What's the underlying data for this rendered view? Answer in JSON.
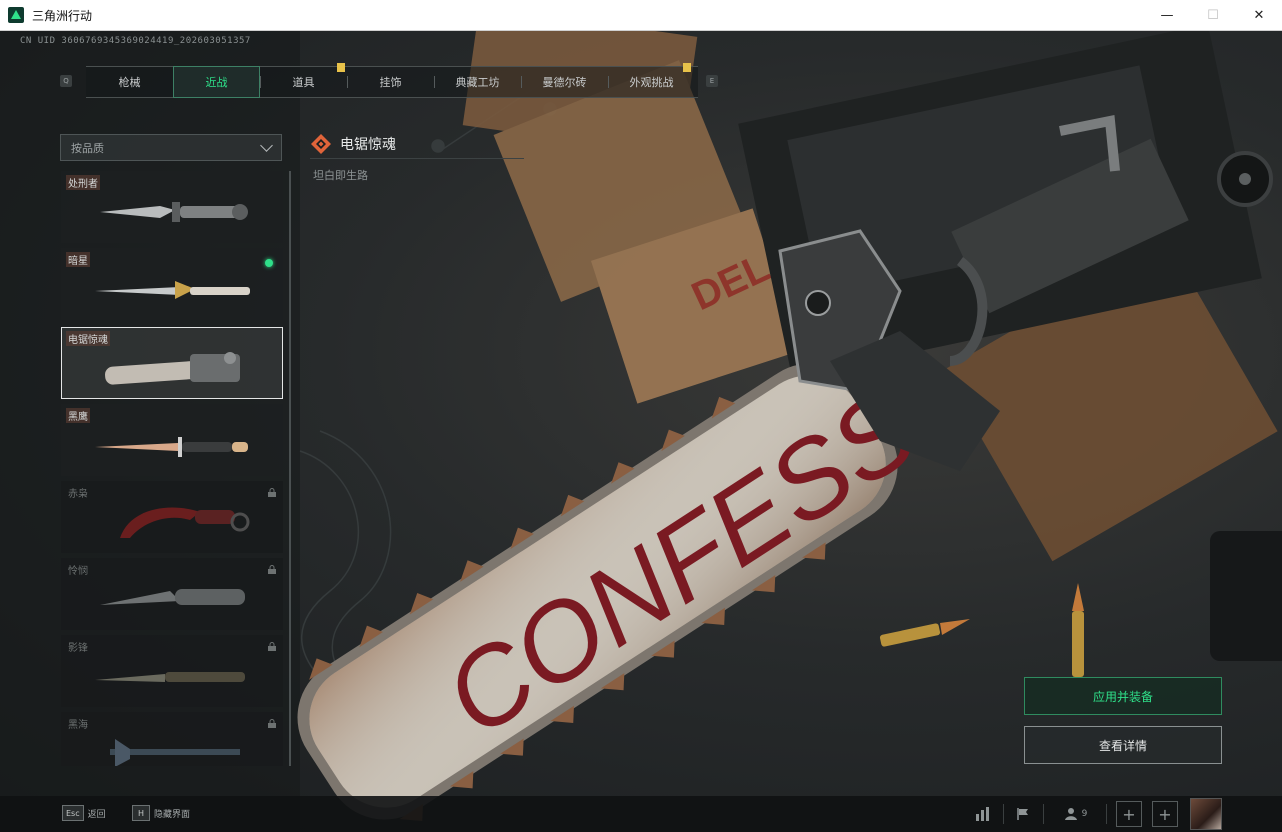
{
  "window": {
    "title": "三角洲行动",
    "minimize": "—",
    "maximize": "☐",
    "close": "✕"
  },
  "uid": "CN UID 3606769345369024419_202603051357",
  "tabs": {
    "left_key": "Q",
    "right_key": "E",
    "items": [
      {
        "label": "枪械",
        "active": false
      },
      {
        "label": "近战",
        "active": true
      },
      {
        "label": "道具",
        "active": false
      },
      {
        "label": "挂饰",
        "active": false
      },
      {
        "label": "典藏工坊",
        "active": false
      },
      {
        "label": "曼德尔砖",
        "active": false
      },
      {
        "label": "外观挑战",
        "active": false
      }
    ]
  },
  "filter": {
    "label": "按品质"
  },
  "items": [
    {
      "name": "处刑者",
      "locked": false,
      "equipped": false,
      "selected": false
    },
    {
      "name": "暗星",
      "locked": false,
      "equipped": true,
      "selected": false
    },
    {
      "name": "电锯惊魂",
      "locked": false,
      "equipped": false,
      "selected": true
    },
    {
      "name": "黑鹰",
      "locked": false,
      "equipped": false,
      "selected": false
    },
    {
      "name": "赤枭",
      "locked": true,
      "equipped": false,
      "selected": false
    },
    {
      "name": "怜悯",
      "locked": true,
      "equipped": false,
      "selected": false
    },
    {
      "name": "影锋",
      "locked": true,
      "equipped": false,
      "selected": false
    },
    {
      "name": "黑海",
      "locked": true,
      "equipped": false,
      "selected": false
    }
  ],
  "selected_skin": {
    "title": "电锯惊魂",
    "subtitle": "坦白即生路",
    "blade_text": "CONFESS"
  },
  "actions": {
    "apply": "应用并装备",
    "details": "查看详情"
  },
  "bottom": {
    "back_key": "Esc",
    "back_label": "返回",
    "hide_key": "H",
    "hide_label": "隐藏界面",
    "friend_count": "9",
    "plus_1": "+",
    "plus_2": "+"
  },
  "colors": {
    "accent": "#2fe08a",
    "tab_marker": "#e8c24a",
    "rarity": "#e0643a"
  }
}
